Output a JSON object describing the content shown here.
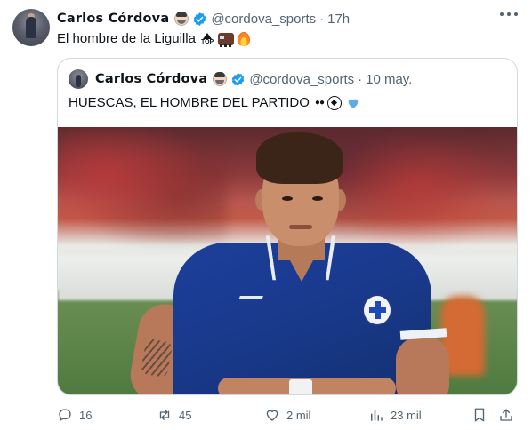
{
  "tweet": {
    "author_name": "Carlos Córdova",
    "handle": "@cordova_sports",
    "time": "17h",
    "separator": "·",
    "text": "El hombre de la Liguilla",
    "top_badge": "TOP",
    "author_emoji": "face-with-beard-emoji"
  },
  "quote": {
    "author_name": "Carlos Córdova",
    "handle": "@cordova_sports",
    "time": "10 may.",
    "separator": "·",
    "text": "HUESCAS, EL HOMBRE DEL PARTIDO"
  },
  "actions": {
    "replies": "16",
    "reposts": "45",
    "likes": "2 mil",
    "views": "23 mil"
  },
  "colors": {
    "verified_blue": "#1d9bf0",
    "secondary_text": "#536471",
    "border": "#cfd9de",
    "heart_blue": "#5dadec"
  },
  "icons": [
    "reply-icon",
    "repost-icon",
    "like-icon",
    "views-icon",
    "bookmark-icon",
    "share-icon",
    "more-icon",
    "verified-icon"
  ]
}
